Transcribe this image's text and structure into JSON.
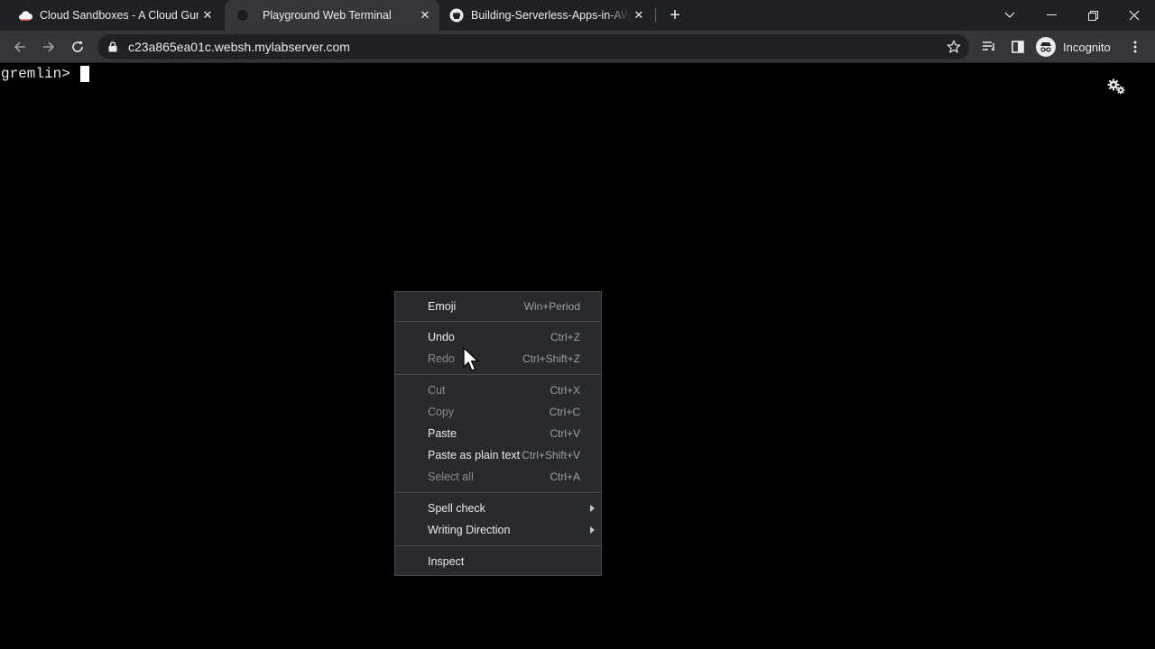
{
  "tabs": [
    {
      "title": "Cloud Sandboxes - A Cloud Guru",
      "favicon": "cloud-icon",
      "active": false
    },
    {
      "title": "Playground Web Terminal",
      "favicon": "terminal-icon",
      "active": true
    },
    {
      "title": "Building-Serverless-Apps-in-AWS",
      "favicon": "github-icon",
      "active": false
    }
  ],
  "newtab_label": "+",
  "toolbar": {
    "url": "c23a865ea01c.websh.mylabserver.com",
    "incognito_label": "Incognito"
  },
  "terminal": {
    "prompt": "gremlin>"
  },
  "context_menu": {
    "items": [
      {
        "label": "Emoji",
        "shortcut": "Win+Period",
        "enabled": true
      },
      {
        "label": "Undo",
        "shortcut": "Ctrl+Z",
        "enabled": true
      },
      {
        "label": "Redo",
        "shortcut": "Ctrl+Shift+Z",
        "enabled": false
      },
      {
        "label": "Cut",
        "shortcut": "Ctrl+X",
        "enabled": false
      },
      {
        "label": "Copy",
        "shortcut": "Ctrl+C",
        "enabled": false
      },
      {
        "label": "Paste",
        "shortcut": "Ctrl+V",
        "enabled": true
      },
      {
        "label": "Paste as plain text",
        "shortcut": "Ctrl+Shift+V",
        "enabled": true
      },
      {
        "label": "Select all",
        "shortcut": "Ctrl+A",
        "enabled": false
      },
      {
        "label": "Spell check",
        "shortcut": "",
        "enabled": true
      },
      {
        "label": "Writing Direction",
        "shortcut": "",
        "enabled": true
      },
      {
        "label": "Inspect",
        "shortcut": "",
        "enabled": true
      }
    ]
  },
  "colors": {
    "tabstrip": "#202124",
    "active_tab": "#35363a",
    "menu_bg": "#292a2d",
    "terminal_bg": "#000000"
  }
}
